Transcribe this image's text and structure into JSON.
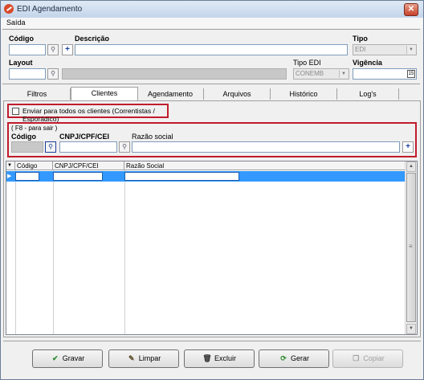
{
  "window": {
    "title": "EDI Agendamento",
    "close_glyph": "✕"
  },
  "menu": {
    "item": "Saída"
  },
  "form": {
    "codigo_label": "Código",
    "descricao_label": "Descrição",
    "tipo_label": "Tipo",
    "tipo_value": "EDI",
    "layout_label": "Layout",
    "tipo_edi_label": "Tipo EDI",
    "tipo_edi_value": "CONEMB",
    "vigencia_label": "Vigência"
  },
  "tabs": [
    {
      "label": "Filtros"
    },
    {
      "label": "Clientes"
    },
    {
      "label": "Agendamento"
    },
    {
      "label": "Arquivos"
    },
    {
      "label": "Histórico"
    },
    {
      "label": "Log's"
    }
  ],
  "clientes": {
    "send_all_label": "Enviar para todos os clientes (Correntistas / Esporádico)",
    "f8_hint": "( F8 - para sair )",
    "codigo_label": "Código",
    "cnpj_label": "CNPJ/CPF/CEI",
    "razao_label": "Razão social"
  },
  "grid": {
    "columns": [
      "Código",
      "CNPJ/CPF/CEI",
      "Razão Social"
    ],
    "row_indicator": "▶"
  },
  "buttons": {
    "gravar": "Gravar",
    "limpar": "Limpar",
    "excluir": "Excluir",
    "gerar": "Gerar",
    "copiar": "Copiar"
  },
  "colors": {
    "highlight_red": "#c01c2c",
    "selection_blue": "#3399ff"
  }
}
